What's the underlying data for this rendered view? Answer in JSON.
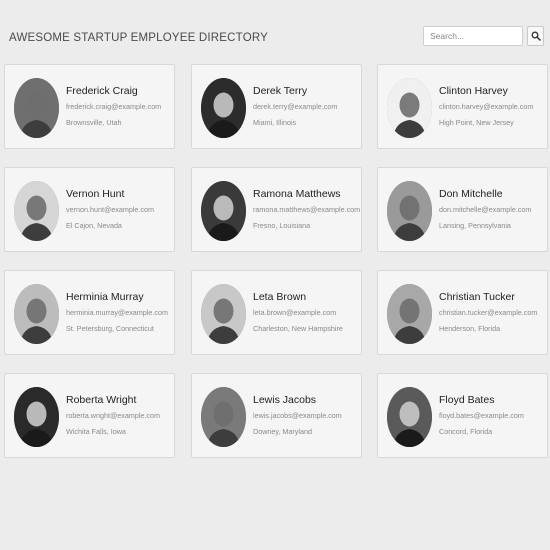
{
  "header": {
    "title": "AWESOME STARTUP EMPLOYEE DIRECTORY"
  },
  "search": {
    "placeholder": "Search...",
    "value": "",
    "button_icon": "search-icon"
  },
  "employees": [
    {
      "name": "Frederick Craig",
      "email": "frederick.craig@example.com",
      "location": "Brownsville, Utah",
      "tone": "#6f6f6f"
    },
    {
      "name": "Derek Terry",
      "email": "derek.terry@example.com",
      "location": "Miami, Illinois",
      "tone": "#2c2c2c"
    },
    {
      "name": "Clinton Harvey",
      "email": "clinton.harvey@example.com",
      "location": "High Point, New Jersey",
      "tone": "#f0f0f0"
    },
    {
      "name": "Vernon Hunt",
      "email": "vernon.hunt@example.com",
      "location": "El Cajon, Nevada",
      "tone": "#d6d6d6"
    },
    {
      "name": "Ramona Matthews",
      "email": "ramona.matthews@example.com",
      "location": "Fresno, Louisiana",
      "tone": "#3a3a3a"
    },
    {
      "name": "Don Mitchelle",
      "email": "don.mitchelle@example.com",
      "location": "Lansing, Pennsylvania",
      "tone": "#9a9a9a"
    },
    {
      "name": "Herminia Murray",
      "email": "herminia.murray@example.com",
      "location": "St. Petersburg, Connecticut",
      "tone": "#bcbcbc"
    },
    {
      "name": "Leta Brown",
      "email": "leta.brown@example.com",
      "location": "Charleston, New Hampshire",
      "tone": "#c8c8c8"
    },
    {
      "name": "Christian Tucker",
      "email": "christian.tucker@example.com",
      "location": "Henderson, Florida",
      "tone": "#a8a8a8"
    },
    {
      "name": "Roberta Wright",
      "email": "roberta.wright@example.com",
      "location": "Wichita Falls, Iowa",
      "tone": "#2a2a2a"
    },
    {
      "name": "Lewis Jacobs",
      "email": "lewis.jacobs@example.com",
      "location": "Downey, Maryland",
      "tone": "#7a7a7a"
    },
    {
      "name": "Floyd Bates",
      "email": "floyd.bates@example.com",
      "location": "Concord, Florida",
      "tone": "#5a5a5a"
    }
  ]
}
